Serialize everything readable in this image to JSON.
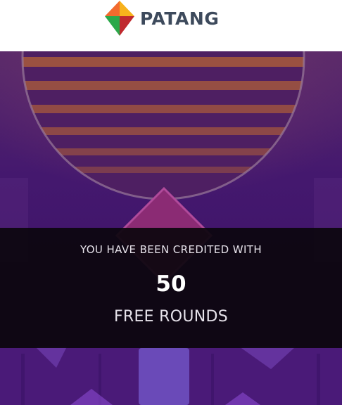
{
  "brand": {
    "name": "PATANG",
    "logo_icon": "kite-icon",
    "text_color": "#3d4a5c",
    "logo_colors": [
      "#f26a2e",
      "#f7b21c",
      "#2ba84a",
      "#c0292e"
    ]
  },
  "notification": {
    "line1": "YOU HAVE BEEN CREDITED WITH",
    "count": "50",
    "line2": "FREE ROUNDS"
  },
  "colors": {
    "background_purple": "#3a1466",
    "overlay": "#0c060e",
    "sun_stripes": "#a85a3c",
    "diamond": "#8b2b74"
  }
}
